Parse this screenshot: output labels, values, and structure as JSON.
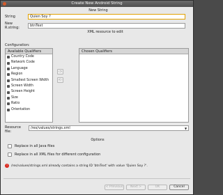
{
  "window": {
    "title": "Create New Android String"
  },
  "new_string": {
    "section_title": "New String",
    "string_label": "String",
    "string_value": "Quien Soy ?",
    "rstring_label": "New R.string:",
    "rstring_value": "btnText"
  },
  "xml_section": {
    "title": "XML resource to edit"
  },
  "configuration": {
    "label": "Configuration:",
    "available_header": "Available Qualifiers",
    "chosen_header": "Chosen Qualifiers",
    "qualifiers": [
      "Country Code",
      "Network Code",
      "Language",
      "Region",
      "Smallest Screen Width",
      "Screen Width",
      "Screen Height",
      "Size",
      "Ratio",
      "Orientation"
    ],
    "add_button": "->",
    "remove_button": "<-"
  },
  "resource_file": {
    "label": "Resource file:",
    "value": "/res/values/strings.xml"
  },
  "options": {
    "title": "Options",
    "replace_java": "Replace in all Java files",
    "replace_xml": "Replace in all XML files for different configuration"
  },
  "error": {
    "message": "/res/values/strings.xml already contains a string ID 'btnText' with value 'Quien Soy ?'."
  },
  "buttons": {
    "previous": "< Previous",
    "next": "Next >",
    "ok": "OK",
    "cancel": "Cancel"
  }
}
